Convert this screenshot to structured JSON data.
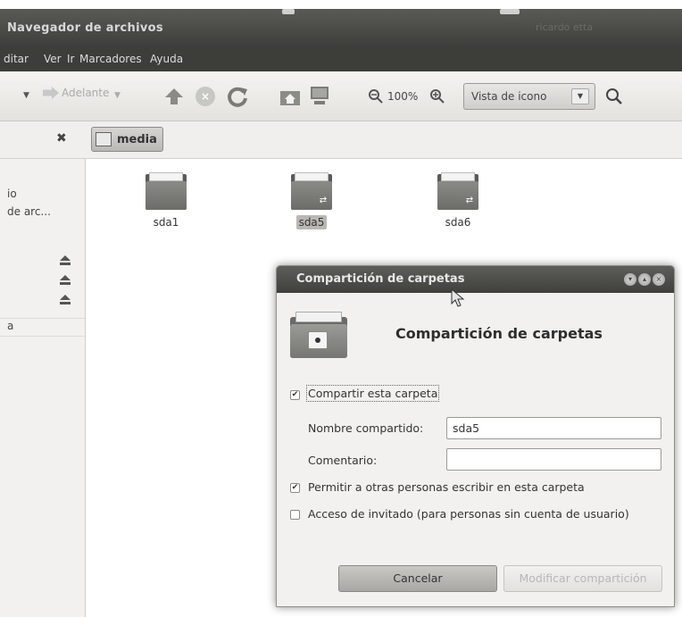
{
  "window": {
    "title": "Navegador de archivos",
    "tray_text": "ricardo etta"
  },
  "menubar": {
    "items": [
      "ditar",
      "Ver",
      "Ir",
      "Marcadores",
      "Ayuda"
    ]
  },
  "toolbar": {
    "forward_label": "Adelante",
    "zoom_level": "100%",
    "view_mode": "Vista de icono"
  },
  "location": {
    "current_folder": "media"
  },
  "sidebar": {
    "items": [
      "io",
      "de arc...",
      "a"
    ]
  },
  "content": {
    "folders": [
      {
        "name": "sda1",
        "shared": false,
        "selected": false
      },
      {
        "name": "sda5",
        "shared": true,
        "selected": true
      },
      {
        "name": "sda6",
        "shared": true,
        "selected": false
      }
    ]
  },
  "dialog": {
    "title": "Compartición de carpetas",
    "heading": "Compartición de carpetas",
    "share_checkbox_label": "Compartir esta carpeta",
    "share_checked": true,
    "share_name_label": "Nombre compartido:",
    "share_name_value": "sda5",
    "comment_label": "Comentario:",
    "comment_value": "",
    "allow_write_label": "Permitir a otras personas escribir en esta carpeta",
    "allow_write_checked": true,
    "guest_access_label": "Acceso de invitado (para personas sin cuenta de usuario)",
    "guest_access_checked": false,
    "cancel_label": "Cancelar",
    "apply_label": "Modificar compartición"
  }
}
